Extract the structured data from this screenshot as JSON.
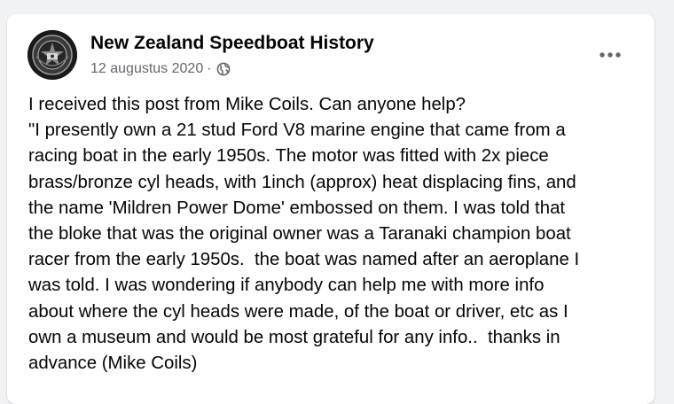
{
  "post": {
    "page_name": "New Zealand Speedboat History",
    "date": "12 augustus 2020",
    "separator": "·",
    "audience_icon": "globe-icon",
    "more_icon": "more-options-icon",
    "body_lines": [
      "I received this post from Mike Coils. Can anyone help?",
      "\"I presently own a 21 stud Ford V8 marine engine that came from a",
      "racing boat in the early 1950s. The motor was fitted with 2x piece",
      "brass/bronze cyl heads, with 1inch (approx) heat displacing fins, and",
      "the name 'Mildren Power Dome' embossed on them. I was told that",
      "the bloke that was the original owner was a Taranaki champion boat",
      "racer from the early 1950s.  the boat was named after an aeroplane I",
      "was told. I was wondering if anybody can help me with more info",
      "about where the cyl heads were made, of the boat or driver, etc as I",
      "own a museum and would be most grateful for any info..  thanks in",
      "advance (Mike Coils)"
    ]
  },
  "colors": {
    "background": "#f0f2f5",
    "card": "#ffffff",
    "primary_text": "#050505",
    "secondary_text": "#65676b"
  }
}
